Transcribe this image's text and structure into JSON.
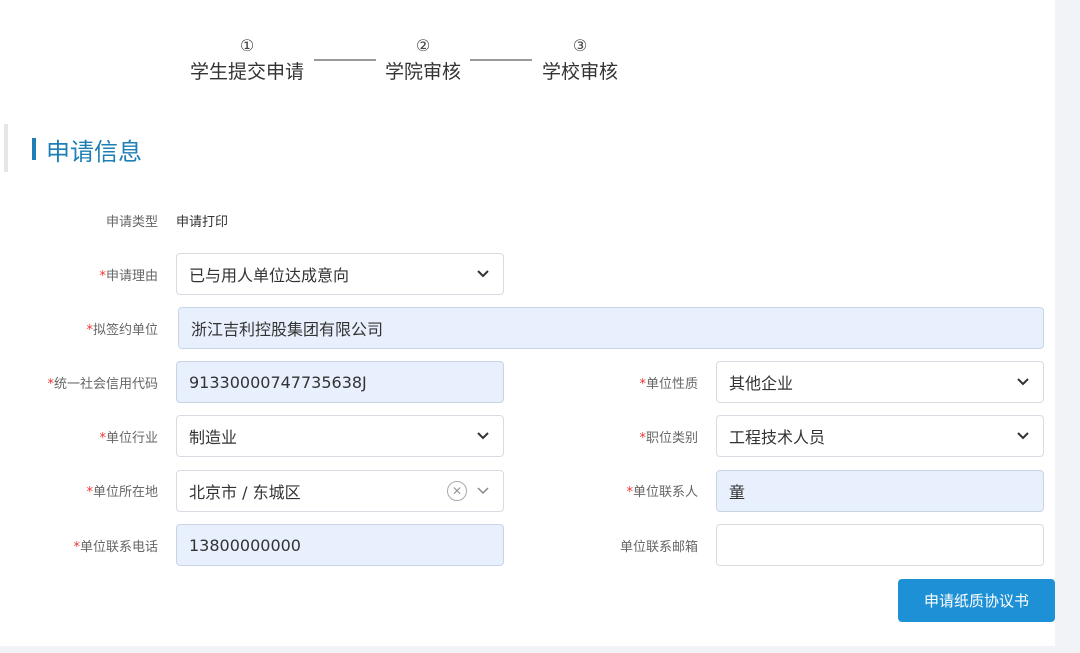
{
  "stepper": {
    "steps": [
      {
        "num": "①",
        "label": "学生提交申请"
      },
      {
        "num": "②",
        "label": "学院审核"
      },
      {
        "num": "③",
        "label": "学校审核"
      }
    ]
  },
  "section": {
    "title": "申请信息"
  },
  "form": {
    "apply_type": {
      "label": "申请类型",
      "value": "申请打印"
    },
    "apply_reason": {
      "label": "申请理由",
      "value": "已与用人单位达成意向"
    },
    "company_name": {
      "label": "拟签约单位",
      "value": "浙江吉利控股集团有限公司"
    },
    "credit_code": {
      "label": "统一社会信用代码",
      "value": "91330000747735638J"
    },
    "company_nature": {
      "label": "单位性质",
      "value": "其他企业"
    },
    "industry": {
      "label": "单位行业",
      "value": "制造业"
    },
    "job_category": {
      "label": "职位类别",
      "value": "工程技术人员"
    },
    "location": {
      "label": "单位所在地",
      "value": "北京市 / 东城区"
    },
    "contact_person": {
      "label": "单位联系人",
      "value": "童"
    },
    "contact_phone": {
      "label": "单位联系电话",
      "value": "13800000000"
    },
    "contact_email": {
      "label": "单位联系邮箱",
      "value": ""
    }
  },
  "required_mark": "*",
  "actions": {
    "submit_label": "申请纸质协议书"
  },
  "colors": {
    "accent": "#1e7fb5",
    "button": "#1e90d6",
    "required": "#ee3333",
    "filled_bg": "#e8f0fe"
  }
}
